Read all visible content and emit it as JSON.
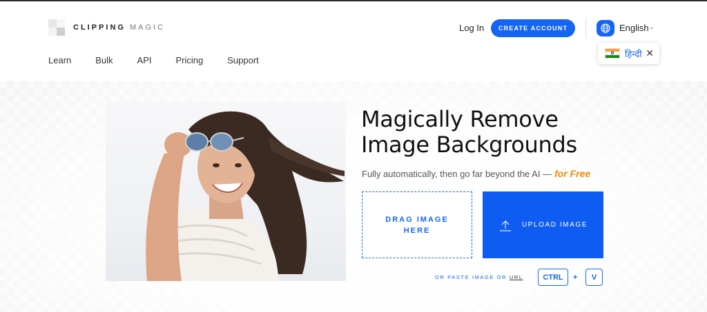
{
  "brand": {
    "name_bold": "CLIPPING",
    "name_light": "MAGIC"
  },
  "nav": {
    "items": [
      {
        "label": "Learn"
      },
      {
        "label": "Bulk"
      },
      {
        "label": "API"
      },
      {
        "label": "Pricing"
      },
      {
        "label": "Support"
      }
    ]
  },
  "header": {
    "login_label": "Log In",
    "create_account_label": "CREATE ACCOUNT",
    "language": {
      "current": "English",
      "icon": "globe-icon",
      "suggestion": {
        "label": "हिन्दी",
        "flag": "india-flag-icon",
        "close_icon": "close-icon"
      }
    }
  },
  "hero": {
    "headline_line1": "Magically Remove",
    "headline_line2": "Image Backgrounds",
    "subtitle": "Fully automatically, then go far beyond the AI —",
    "subtitle_highlight": "for Free",
    "drag_line1": "DRAG IMAGE",
    "drag_line2": "HERE",
    "upload_label": "UPLOAD IMAGE",
    "upload_icon": "upload-icon",
    "paste_prefix": "OR PASTE IMAGE OR",
    "paste_link": "URL",
    "key_ctrl": "CTRL",
    "key_plus": "+",
    "key_v": "V"
  },
  "colors": {
    "accent": "#1565f5",
    "highlight": "#f08c00",
    "text": "#111111"
  }
}
